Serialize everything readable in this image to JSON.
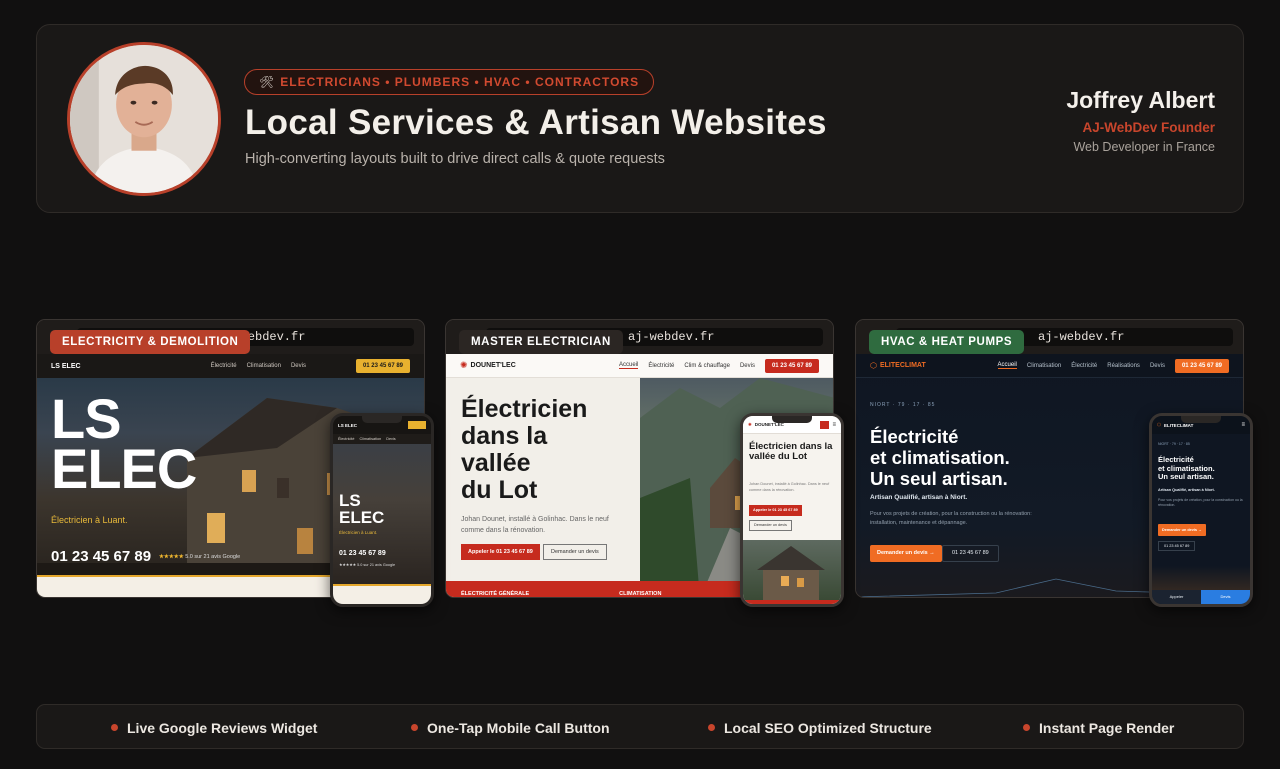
{
  "header": {
    "pill_icon": "🛠",
    "pill_text": "ELECTRICIANS • PLUMBERS • HVAC • CONTRACTORS",
    "title": "Local Services & Artisan Websites",
    "subtitle": "High-converting layouts built to drive direct calls & quote requests",
    "author_name": "Joffrey Albert",
    "author_role": "AJ-WebDev Founder",
    "author_location": "Web Developer in France"
  },
  "showcases": [
    {
      "tag": "ELECTRICITY & DEMOLITION",
      "tag_color": "#b8402a",
      "url": "aj-webdev.fr",
      "site": {
        "logo": "LS ELEC",
        "nav": [
          "Électricité",
          "Climatisation",
          "Devis"
        ],
        "cta": "01 23 45 67 89",
        "headline_1": "LS",
        "headline_2": "ELEC",
        "sub": "Électricien à Luant.",
        "phone": "01 23 45 67 89",
        "stars": "★★★★★",
        "rating": "5.0 sur 21 avis Google"
      },
      "mobile": {
        "logo": "LS ELEC",
        "nav": [
          "Électricité",
          "Climatisation",
          "Devis"
        ],
        "headline_1": "LS",
        "headline_2": "ELEC",
        "sub": "Électricien à Luant.",
        "phone": "01 23 45 67 89",
        "rating": "★★★★★ 5.0 sur 21 avis Google"
      }
    },
    {
      "tag": "MASTER ELECTRICIAN",
      "tag_color": "#2b2623",
      "url": "aj-webdev.fr",
      "site": {
        "logo": "DOUNET'LEC",
        "nav": [
          "Accueil",
          "Électricité",
          "Clim & chauffage",
          "Devis"
        ],
        "cta": "01 23 45 67 89",
        "headline": [
          "Électricien",
          "dans la",
          "vallée",
          "du Lot"
        ],
        "text": "Johan Dounet, installé à Golinhac. Dans le neuf comme dans la rénovation.",
        "btn_call": "Appeler le 01 23 45 67 89",
        "btn_quote": "Demander un devis",
        "band_1": "ÉLECTRICITÉ GÉNÉRALE",
        "band_2": "CLIMATISATION"
      },
      "mobile": {
        "logo": "DOUNET'LEC",
        "headline": "Électricien dans la vallée du Lot",
        "text": "Johan Dounet, installé à Golinhac. Dans le neuf comme dans la rénovation.",
        "btn_call": "Appeler le 01 23 45 67 89",
        "btn_quote": "Demander un devis"
      }
    },
    {
      "tag": "HVAC & HEAT PUMPS",
      "tag_color": "#2f6b3f",
      "url": "aj-webdev.fr",
      "site": {
        "logo": "ELITECLIMAT",
        "nav": [
          "Accueil",
          "Climatisation",
          "Électricité",
          "Réalisations",
          "Devis"
        ],
        "cta": "01 23 45 67 89",
        "kicker": "NIORT · 79 · 17 · 85",
        "headline": [
          "Électricité",
          "et climatisation.",
          "Un seul artisan."
        ],
        "lead": "Artisan Qualifié, artisan à Niort.",
        "text": "Pour vos projets de création, pour la construction ou la rénovation: installation, maintenance et dépannage.",
        "btn_quote": "Demander un devis →",
        "btn_call": "01 23 45 67 89"
      },
      "mobile": {
        "logo": "ELITECLIMAT",
        "kicker": "NIORT · 79 · 17 · 85",
        "headline": [
          "Électricité",
          "et climatisation.",
          "Un seul artisan."
        ],
        "lead": "Artisan Qualifié, artisan à Niort.",
        "text": "Pour vos projets de création, pour la construction ou la rénovation.",
        "btn_quote": "Demander un devis →",
        "btn_call": "01 23 45 67 89",
        "bottom_call": "Appeler",
        "bottom_quote": "Devis"
      }
    }
  ],
  "features": [
    "Live Google Reviews Widget",
    "One-Tap Mobile Call Button",
    "Local SEO Optimized Structure",
    "Instant Page Render"
  ],
  "colors": {
    "accent": "#c8452c",
    "background": "#111010",
    "card": "#1a1817"
  }
}
